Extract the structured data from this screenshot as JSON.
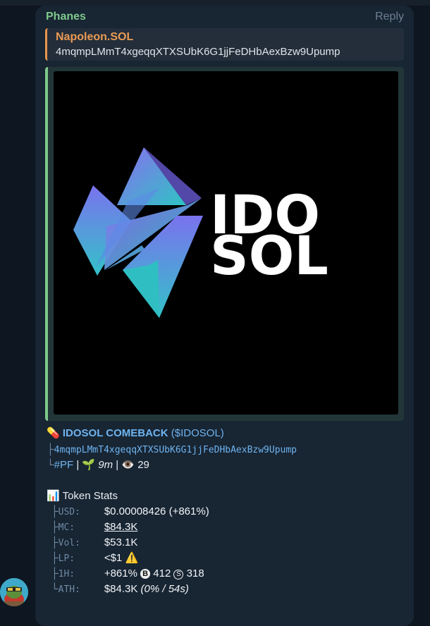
{
  "message": {
    "sender": "Phanes",
    "reply_label": "Reply",
    "quote": {
      "name": "Napoleon.SOL",
      "text": "4mqmpLMmT4xgeqqXTXSUbK6G1jjFeDHbAexBzw9Upump"
    },
    "image": {
      "logo_line1": "IDO",
      "logo_line2": "SOL"
    },
    "token": {
      "pill_icon": "💊",
      "name": "IDOSOL COMEBACK",
      "ticker": "($IDOSOL)",
      "branch1": "├",
      "address": "4mqmpLMmT4xgeqqXTXSUbK6G1jjFeDHbAexBzw9Upump",
      "branch2": "└",
      "tag": "#PF",
      "sep": "|",
      "age_icon": "🌱",
      "age": "9m",
      "views_icon": "👁️",
      "views": "29"
    },
    "stats": {
      "icon": "📊",
      "title": "Token Stats",
      "rows": [
        {
          "branch": "├",
          "label": "USD:",
          "value": "$0.00008426",
          "extra": "(+861%)"
        },
        {
          "branch": "├",
          "label": "MC:",
          "value": "$84.3K"
        },
        {
          "branch": "├",
          "label": "Vol:",
          "value": "$53.1K"
        },
        {
          "branch": "├",
          "label": "LP:",
          "value": "<$1",
          "extra": "⚠️"
        },
        {
          "branch": "├",
          "label": "1H:",
          "value": "+861%",
          "b_icon": "B",
          "b_val": "412",
          "s_icon": "S",
          "s_val": "318"
        },
        {
          "branch": "└",
          "label": "ATH:",
          "value": "$84.3K",
          "extra": "(0% / 54s)"
        }
      ]
    }
  },
  "colors": {
    "background": "#0e1621",
    "bubble": "#182533",
    "sender": "#7ec88b",
    "quote_accent": "#e8964e",
    "link": "#6eb4f0"
  }
}
